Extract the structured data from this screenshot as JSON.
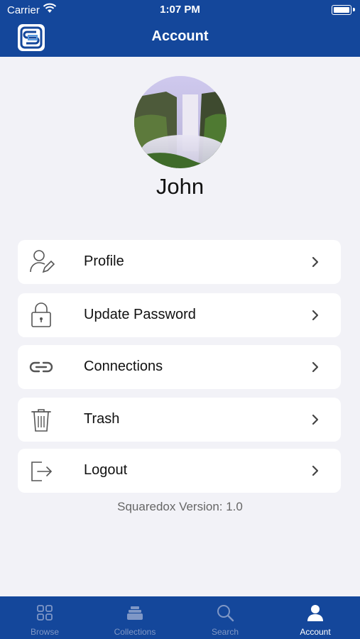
{
  "status_bar": {
    "carrier": "Carrier",
    "time": "1:07 PM"
  },
  "header": {
    "title": "Account",
    "logo_icon": "squaredox-logo-icon",
    "background": "#14479b"
  },
  "profile": {
    "name": "John"
  },
  "menu": [
    {
      "label": "Profile",
      "icon": "user-edit-icon"
    },
    {
      "label": "Update Password",
      "icon": "lock-icon"
    },
    {
      "label": "Connections",
      "icon": "link-icon"
    },
    {
      "label": "Trash",
      "icon": "trash-icon"
    },
    {
      "label": "Logout",
      "icon": "logout-icon"
    }
  ],
  "version_text": "Squaredox Version: 1.0",
  "tabs": [
    {
      "label": "Browse",
      "icon": "grid-icon",
      "active": false
    },
    {
      "label": "Collections",
      "icon": "stack-icon",
      "active": false
    },
    {
      "label": "Search",
      "icon": "search-icon",
      "active": false
    },
    {
      "label": "Account",
      "icon": "person-icon",
      "active": true
    }
  ],
  "colors": {
    "brand": "#14479b",
    "background": "#f2f2f7",
    "inactive_tab": "#7f97c6"
  }
}
